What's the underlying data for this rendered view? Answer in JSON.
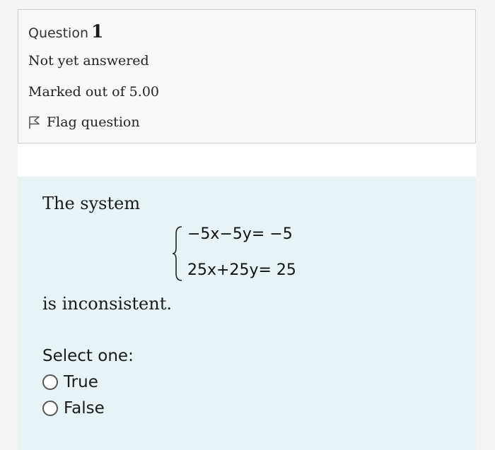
{
  "question": {
    "label": "Question",
    "number": "1",
    "status": "Not yet answered",
    "marks": "Marked out of 5.00",
    "flag_label": "Flag question",
    "flag_icon": "flag-outline-icon"
  },
  "content": {
    "intro": "The system",
    "equation_line1": "−5x−5y= −5",
    "equation_line2": "25x+25y= 25",
    "conclusion": "is inconsistent.",
    "select_label": "Select one:",
    "options": [
      {
        "label": "True",
        "selected": false
      },
      {
        "label": "False",
        "selected": false
      }
    ]
  },
  "colors": {
    "info_background": "#f8f8f8",
    "content_background": "#e7f3f5",
    "border": "#cfcfcf"
  }
}
